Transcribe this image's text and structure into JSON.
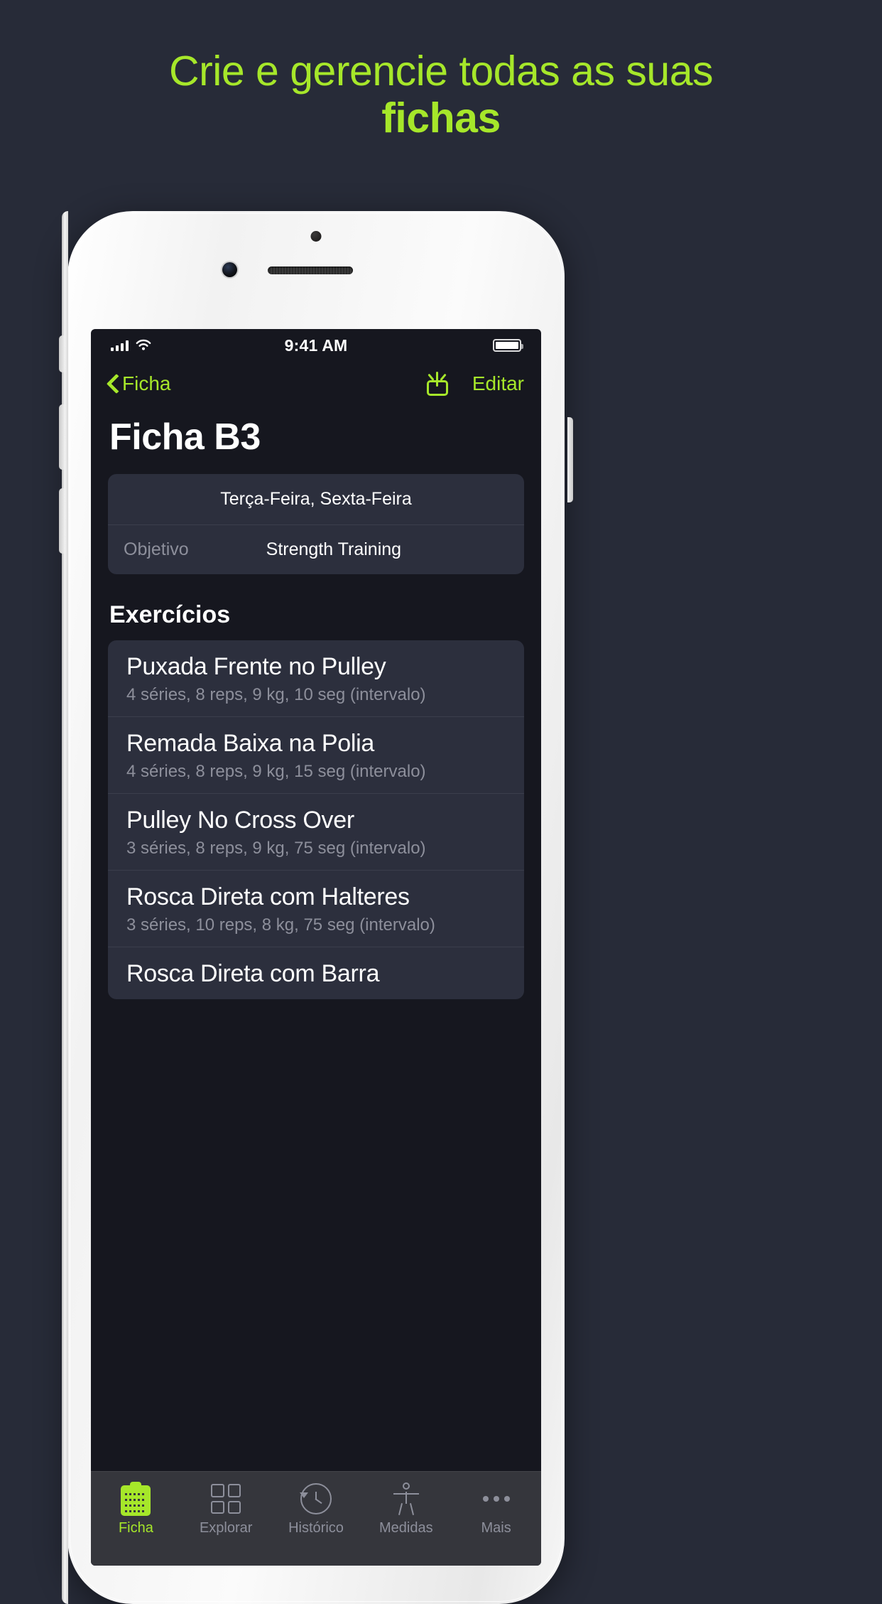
{
  "promo": {
    "line1": "Crie e gerencie todas as suas",
    "line2": "fichas",
    "accent_color": "#a6e72a"
  },
  "status_bar": {
    "time": "9:41 AM",
    "signal_icon": "cellular-bars-icon",
    "wifi_icon": "wifi-icon",
    "battery_icon": "battery-full-icon"
  },
  "navbar": {
    "back_icon": "chevron-left-icon",
    "back_label": "Ficha",
    "share_icon": "share-icon",
    "edit_label": "Editar"
  },
  "page_title": "Ficha B3",
  "info": {
    "days": "Terça-Feira, Sexta-Feira",
    "goal_label": "Objetivo",
    "goal_value": "Strength Training"
  },
  "exercises_heading": "Exercícios",
  "exercises": [
    {
      "name": "Puxada Frente no Pulley",
      "detail": "4 séries, 8 reps, 9 kg, 10 seg (intervalo)"
    },
    {
      "name": "Remada Baixa na Polia",
      "detail": "4 séries, 8 reps, 9 kg, 15 seg (intervalo)"
    },
    {
      "name": "Pulley No Cross Over",
      "detail": "3 séries, 8 reps, 9 kg, 75 seg (intervalo)"
    },
    {
      "name": "Rosca Direta com Halteres",
      "detail": "3 séries, 10 reps, 8 kg, 75 seg (intervalo)"
    },
    {
      "name": "Rosca Direta com Barra",
      "detail": ""
    }
  ],
  "tabbar": [
    {
      "label": "Ficha",
      "icon": "clipboard-icon",
      "active": true
    },
    {
      "label": "Explorar",
      "icon": "grid-icon",
      "active": false
    },
    {
      "label": "Histórico",
      "icon": "clock-back-icon",
      "active": false
    },
    {
      "label": "Medidas",
      "icon": "body-figure-icon",
      "active": false
    },
    {
      "label": "Mais",
      "icon": "ellipsis-icon",
      "active": false
    }
  ]
}
